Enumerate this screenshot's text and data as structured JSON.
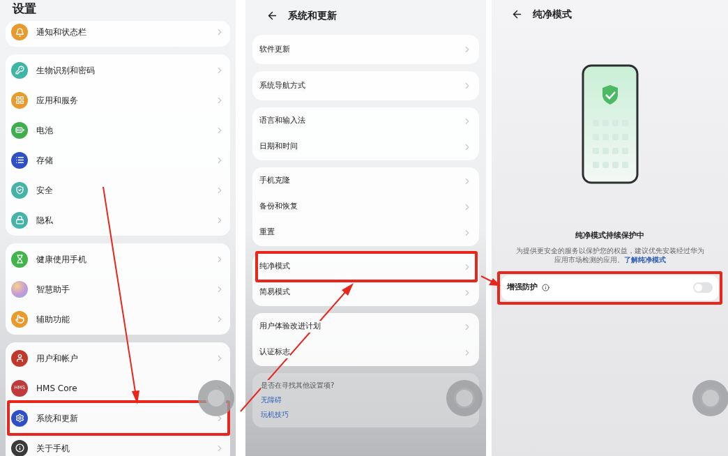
{
  "settings": {
    "title": "设置",
    "groups": [
      {
        "items": [
          {
            "label": "通知和状态栏",
            "color": "#e89a2c",
            "highlighted": false
          }
        ]
      },
      {
        "items": [
          {
            "label": "生物识别和密码",
            "color": "#3fb5a5",
            "highlighted": false
          },
          {
            "label": "应用和服务",
            "color": "#e89a2c",
            "highlighted": false
          },
          {
            "label": "电池",
            "color": "#3fae4f",
            "highlighted": false
          },
          {
            "label": "存储",
            "color": "#2f4fc7",
            "highlighted": false
          },
          {
            "label": "安全",
            "color": "#45b3a8",
            "highlighted": false
          },
          {
            "label": "隐私",
            "color": "#45b3a8",
            "highlighted": false
          }
        ]
      },
      {
        "items": [
          {
            "label": "健康使用手机",
            "color": "#3fb54a",
            "highlighted": false
          },
          {
            "label": "智慧助手",
            "color": "#c59ad8",
            "highlighted": false
          },
          {
            "label": "辅助功能",
            "color": "#e89a2c",
            "highlighted": false
          }
        ]
      },
      {
        "items": [
          {
            "label": "用户和帐户",
            "color": "#c0392b",
            "highlighted": false
          },
          {
            "label": "HMS Core",
            "color": "#c0393b",
            "icon_text": "HMS",
            "highlighted": false
          },
          {
            "label": "系统和更新",
            "color": "#2f4fc7",
            "highlighted": true
          },
          {
            "label": "关于手机",
            "color": "#3a3a3a",
            "highlighted": false
          }
        ]
      }
    ]
  },
  "system_update": {
    "title": "系统和更新",
    "groups": [
      {
        "items": [
          {
            "label": "软件更新",
            "highlighted": false
          }
        ]
      },
      {
        "items": [
          {
            "label": "系统导航方式",
            "highlighted": false
          }
        ]
      },
      {
        "items": [
          {
            "label": "语言和输入法",
            "highlighted": false
          },
          {
            "label": "日期和时间",
            "highlighted": false
          }
        ]
      },
      {
        "items": [
          {
            "label": "手机克隆",
            "highlighted": false
          },
          {
            "label": "备份和恢复",
            "highlighted": false
          },
          {
            "label": "重置",
            "highlighted": false
          }
        ]
      },
      {
        "items": [
          {
            "label": "纯净模式",
            "highlighted": true
          },
          {
            "label": "简易模式",
            "highlighted": false
          }
        ]
      },
      {
        "items": [
          {
            "label": "用户体验改进计划",
            "highlighted": false
          },
          {
            "label": "认证标志",
            "highlighted": false
          }
        ]
      }
    ],
    "suggestions": {
      "title": "是否在寻找其他设置项?",
      "links": [
        "无障碍",
        "玩机技巧"
      ]
    }
  },
  "pure_mode": {
    "title": "纯净模式",
    "status": "纯净模式持续保护中",
    "description": "为提供更安全的服务以保护您的权益，建议优先安装经过华为应用市场检测的应用。",
    "link": "了解纯净模式",
    "toggle": {
      "label": "增强防护",
      "on": false,
      "highlighted": true
    }
  }
}
